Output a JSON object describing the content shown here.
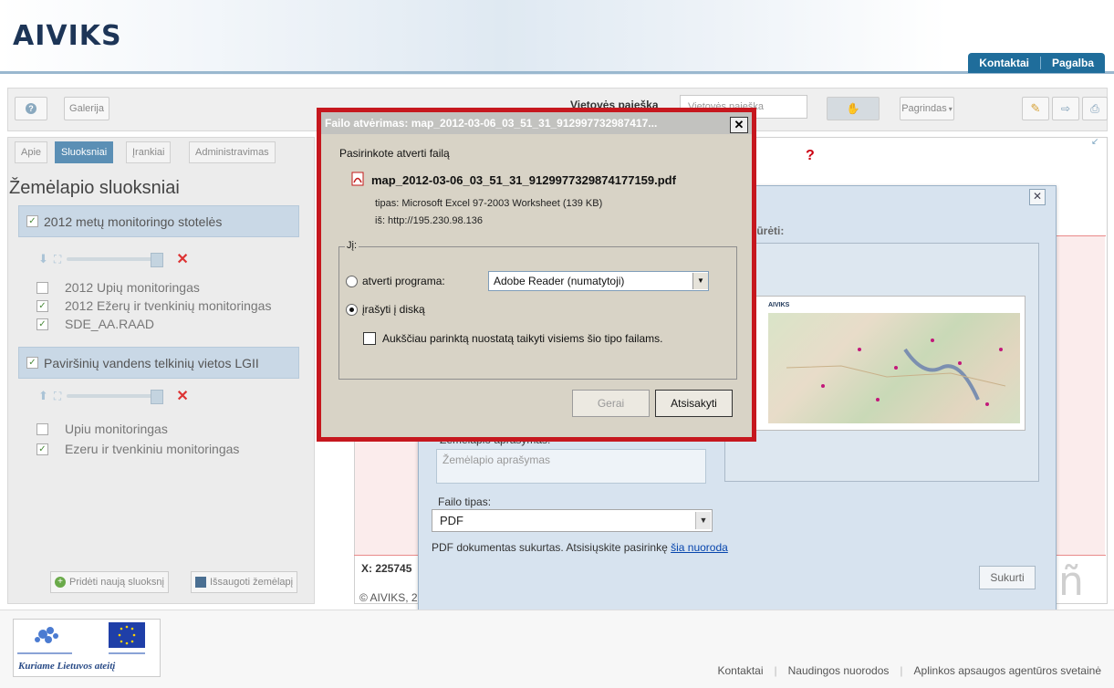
{
  "app": {
    "logo": "AIVIKS"
  },
  "header": {
    "links": [
      "Kontaktai",
      "Pagalba"
    ]
  },
  "toolbar": {
    "help_icon": "help-icon",
    "gallery": "Galerija",
    "search_label": "Vietovės paieška",
    "search_placeholder": "Vietovės paieška",
    "base_map": "Pagrindas",
    "base_map_icon": "chevron-down-icon"
  },
  "left_panel": {
    "tabs": [
      "Apie",
      "Sluoksniai",
      "Įrankiai",
      "Administravimas"
    ],
    "active_tab": "Sluoksniai",
    "title": "Žemėlapio sluoksniai",
    "groups": [
      {
        "name": "2012 metų monitoringo stotelės",
        "layers": [
          {
            "name": "2012 Upių monitoringas",
            "checked": false
          },
          {
            "name": "2012 Ežerų ir tvenkinių monitoringas",
            "checked": true
          },
          {
            "name": "SDE_AA.RAAD",
            "checked": true
          }
        ]
      },
      {
        "name": "Paviršinių vandens telkinių vietos LGII",
        "layers": [
          {
            "name": "Upiu monitoringas",
            "checked": false
          },
          {
            "name": "Ezeru ir tvenkiniu monitoringas",
            "checked": true
          }
        ]
      }
    ],
    "add_layer": "Pridėti naują sluoksnį",
    "save_map": "Išsaugoti žemėlapį"
  },
  "map": {
    "coords_prefix": "X: 225745",
    "copyright": "© AIVIKS, 2",
    "marker": "?"
  },
  "save_dialog": {
    "heading": "iūrėti:",
    "preview_title": "AIVIKS",
    "description_label": "Žemėlapio aprašymas:",
    "description_placeholder": "Žemėlapio aprašymas",
    "filetype_label": "Failo tipas:",
    "filetype_value": "PDF",
    "message": "PDF dokumentas sukurtas. Atsisiųskite pasirinkę ",
    "message_link": "šia nuoroda",
    "create_button": "Sukurti"
  },
  "file_dialog": {
    "title": "Failo atvėrimas: map_2012-03-06_03_51_31_912997732987417...",
    "prompt": "Pasirinkote atverti failą",
    "filename": "map_2012-03-06_03_51_31_9129977329874177159.pdf",
    "type_line": "tipas: Microsoft Excel 97-2003 Worksheet (139 KB)",
    "from_line": "iš: http://195.230.98.136",
    "group_label": "Jį:",
    "open_with_label": "atverti programa:",
    "app_value": "Adobe Reader  (numatytoji)",
    "save_label": "įrašyti į diską",
    "save_selected": true,
    "apply_all_label": "Aukščiau parinktą nuostatą taikyti visiems šio tipo failams.",
    "ok": "Gerai",
    "cancel": "Atsisakyti",
    "highlight_color": "#c6171e"
  },
  "footer": {
    "eu_slogan": "Kuriame Lietuvos ateitį",
    "links": [
      "Kontaktai",
      "Naudingos nuorodos",
      "Aplinkos apsaugos agentūros svetainė"
    ]
  }
}
